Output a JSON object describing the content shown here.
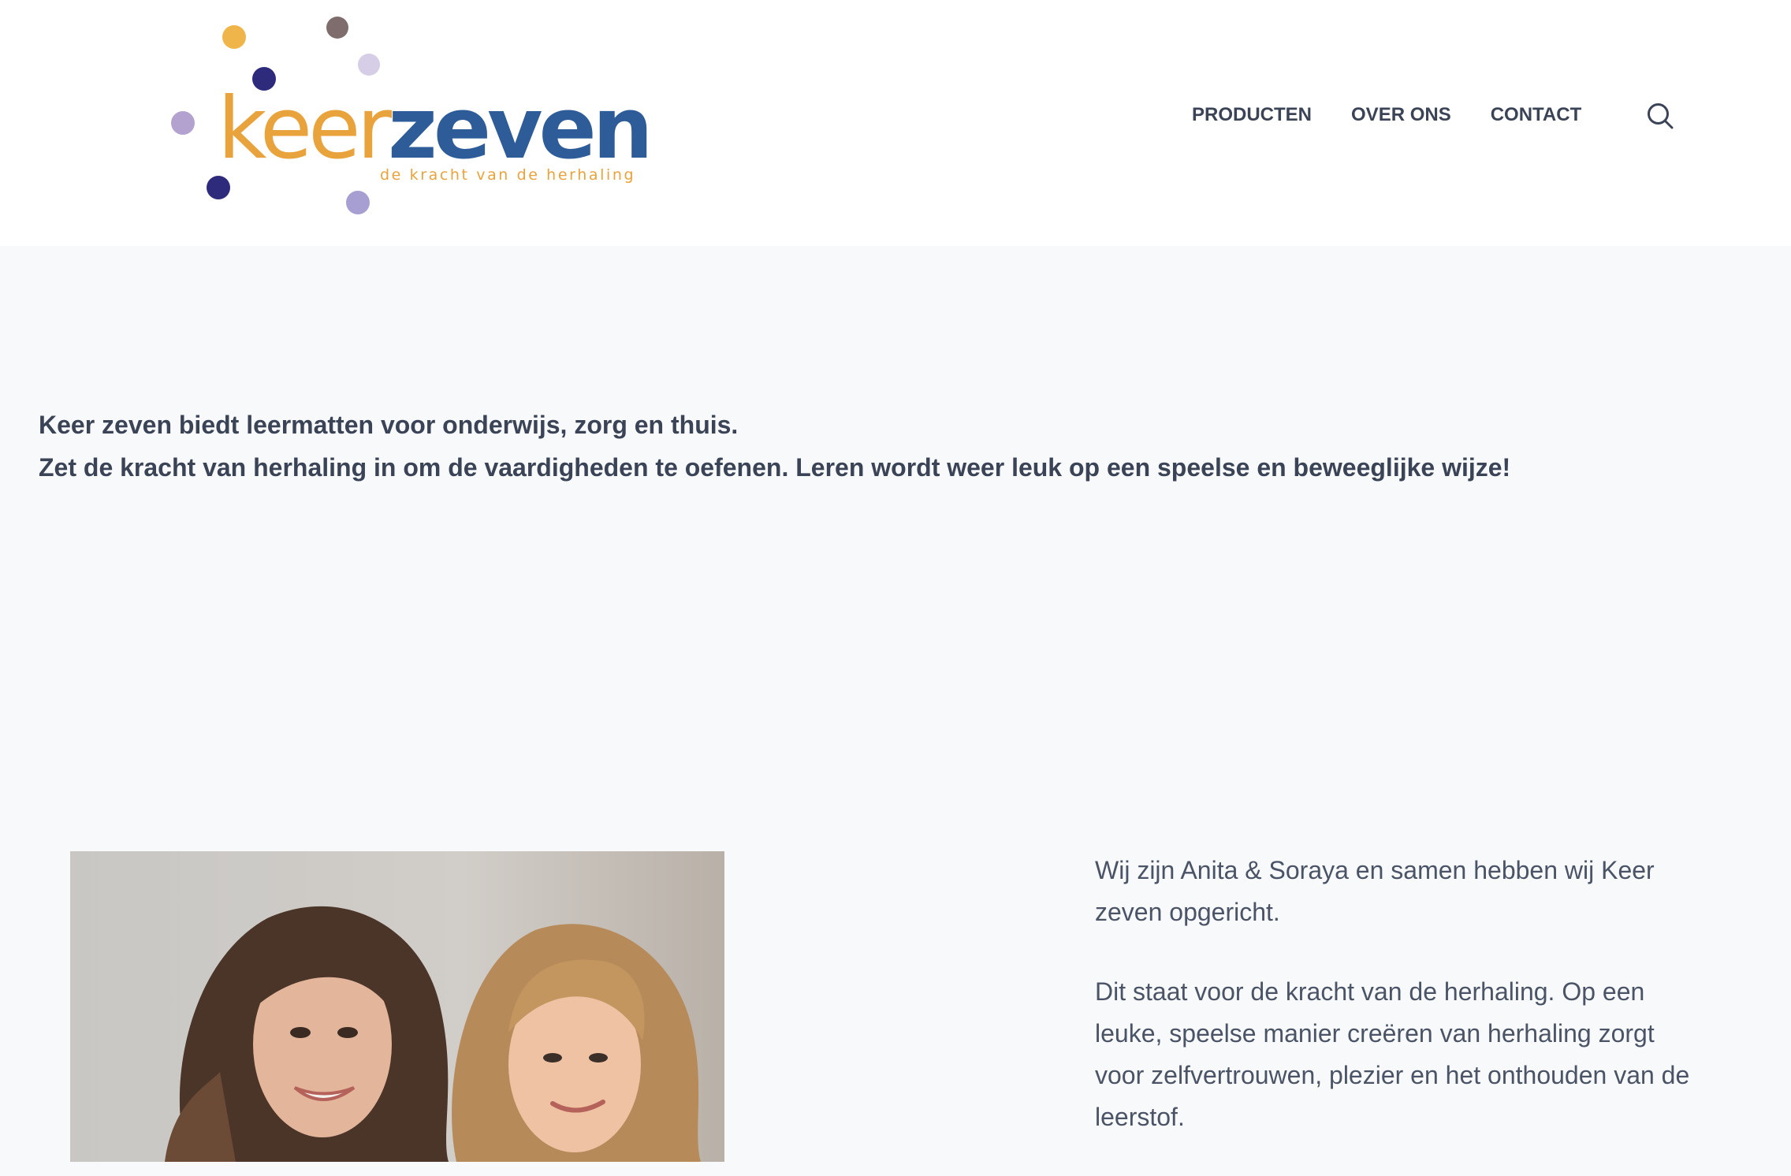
{
  "header": {
    "logo": {
      "word_orange": "keer",
      "word_blue": "zeven",
      "tagline": "de kracht van de herhaling",
      "dot_colors": [
        "#efb54a",
        "#7f6d6e",
        "#d6cde6",
        "#2e2b7d",
        "#b3a2d0",
        "#2e2b7d",
        "#a79fd1"
      ]
    },
    "nav": {
      "items": [
        {
          "label": "PRODUCTEN"
        },
        {
          "label": "OVER ONS"
        },
        {
          "label": "CONTACT"
        }
      ],
      "search_icon": "search-icon"
    }
  },
  "intro": {
    "line1": "Keer zeven biedt leermatten voor onderwijs, zorg en thuis.",
    "line2": "Zet de kracht van herhaling in om de vaardigheden te oefenen. Leren wordt weer leuk op een speelse en beweeglijke wijze!"
  },
  "about": {
    "photo_description_icon": "photo-of-two-women",
    "paragraphs": [
      "Wij zijn Anita & Soraya en samen hebben wij Keer zeven opgericht.",
      "Dit staat voor de kracht van de herhaling. Op een leuke, speelse manier creëren van herhaling zorgt voor zelfvertrouwen, plezier en het onthouden van de leerstof."
    ]
  },
  "colors": {
    "text": "#3a4456",
    "page_background": "#f8f9fb",
    "header_background": "#ffffff",
    "brand_orange": "#e8a33c",
    "brand_blue": "#2d5c99"
  }
}
